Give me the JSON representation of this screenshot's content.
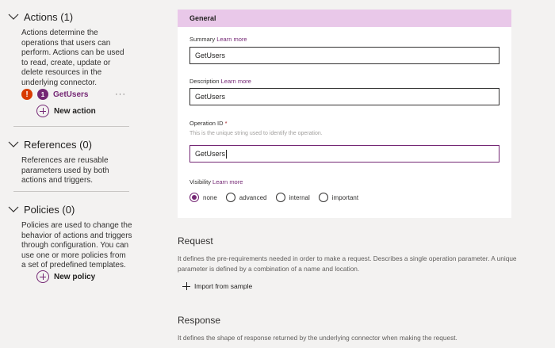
{
  "sidebar": {
    "actions": {
      "title": "Actions (1)",
      "description": "Actions determine the operations that users can perform. Actions can be used to read, create, update or delete resources in the underlying connector.",
      "item": {
        "error_glyph": "!",
        "badge": "1",
        "name": "GetUsers",
        "more": "···"
      },
      "new_label": "New action"
    },
    "references": {
      "title": "References (0)",
      "description": "References are reusable parameters used by both actions and triggers."
    },
    "policies": {
      "title": "Policies (0)",
      "description": "Policies are used to change the behavior of actions and triggers through configuration. You can use one or more policies from a set of predefined templates.",
      "new_label": "New policy"
    }
  },
  "general": {
    "header": "General",
    "summary": {
      "label": "Summary",
      "learn": "Learn more",
      "value": "GetUsers"
    },
    "description": {
      "label": "Description",
      "learn": "Learn more",
      "value": "GetUsers"
    },
    "operation_id": {
      "label": "Operation ID",
      "required": "*",
      "helper": "This is the unique string used to identify the operation.",
      "value": "GetUsers"
    },
    "visibility": {
      "label": "Visibility",
      "learn": "Learn more",
      "options": [
        "none",
        "advanced",
        "internal",
        "important"
      ],
      "selected": "none"
    }
  },
  "request": {
    "title": "Request",
    "description": "It defines the pre-requirements needed in order to make a request. Describes a single operation parameter. A unique parameter is defined by a combination of a name and location.",
    "import_label": "Import from sample"
  },
  "response": {
    "title": "Response",
    "description": "It defines the shape of response returned by the underlying connector when making the request."
  },
  "colors": {
    "accent": "#742774",
    "header_bg": "#e9c8e9",
    "error": "#d83b01",
    "background": "#f3f2f1"
  }
}
